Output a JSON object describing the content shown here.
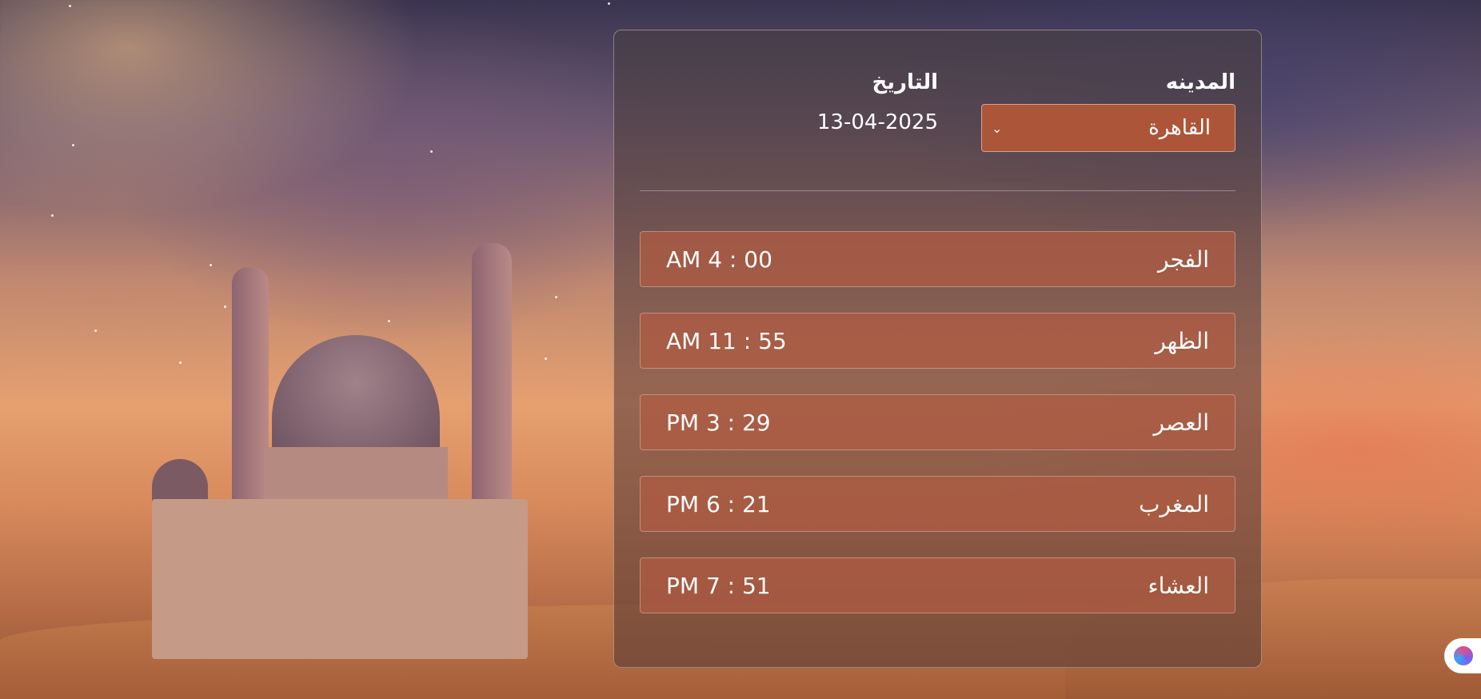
{
  "city": {
    "label": "المدينه",
    "selected": "القاهرة",
    "chevron_icon": "chevron-down-icon"
  },
  "date": {
    "label": "التاريخ",
    "value": "13-04-2025"
  },
  "prayers": [
    {
      "name": "الفجر",
      "time": "AM 4 : 00"
    },
    {
      "name": "الظهر",
      "time": "AM 11 : 55"
    },
    {
      "name": "العصر",
      "time": "PM 3 : 29"
    },
    {
      "name": "المغرب",
      "time": "PM 6 : 21"
    },
    {
      "name": "العشاء",
      "time": "PM 7 : 51"
    }
  ],
  "colors": {
    "accent": "#ad5538",
    "row_bg": "#b25c42"
  },
  "assistant_icon": "brain-icon"
}
